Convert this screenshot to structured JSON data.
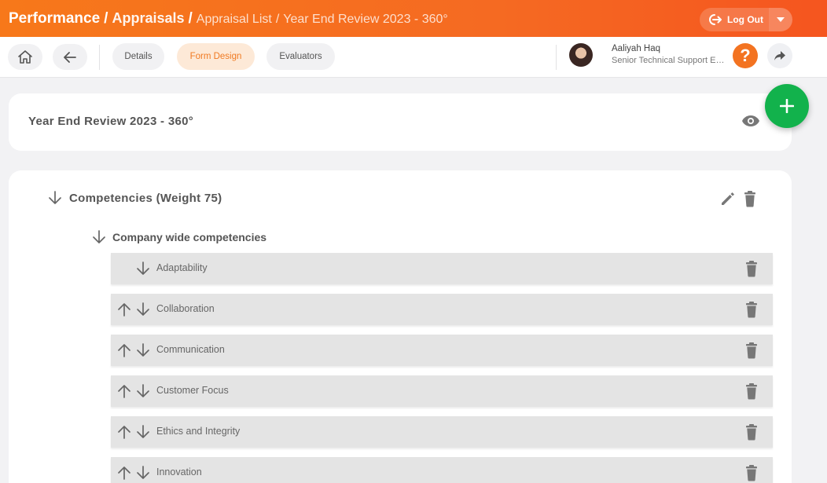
{
  "header": {
    "crumb_main": "Performance",
    "crumb_mid": "Appraisals",
    "crumb_list": "Appraisal List",
    "crumb_current": "Year End Review 2023 - 360°",
    "separator": "/",
    "logout_label": "Log Out",
    "brand_color": "#f56a22"
  },
  "toolbar": {
    "tabs": [
      {
        "label": "Details"
      },
      {
        "label": "Form Design",
        "active": true
      },
      {
        "label": "Evaluators"
      }
    ],
    "user": {
      "name": "Aaliyah Haq",
      "role": "Senior Technical Support Engineer"
    },
    "help_label": "?"
  },
  "form": {
    "title": "Year End Review 2023 - 360°"
  },
  "section": {
    "title": "Competencies (Weight 75)",
    "group": {
      "title": "Company wide competencies",
      "items": [
        {
          "label": "Adaptability"
        },
        {
          "label": "Collaboration"
        },
        {
          "label": "Communication"
        },
        {
          "label": "Customer Focus"
        },
        {
          "label": "Ethics and Integrity"
        },
        {
          "label": "Innovation"
        }
      ]
    }
  },
  "colors": {
    "accent": "#f37321",
    "fab": "#12b24c",
    "icon_gray": "#7a7a7a"
  }
}
